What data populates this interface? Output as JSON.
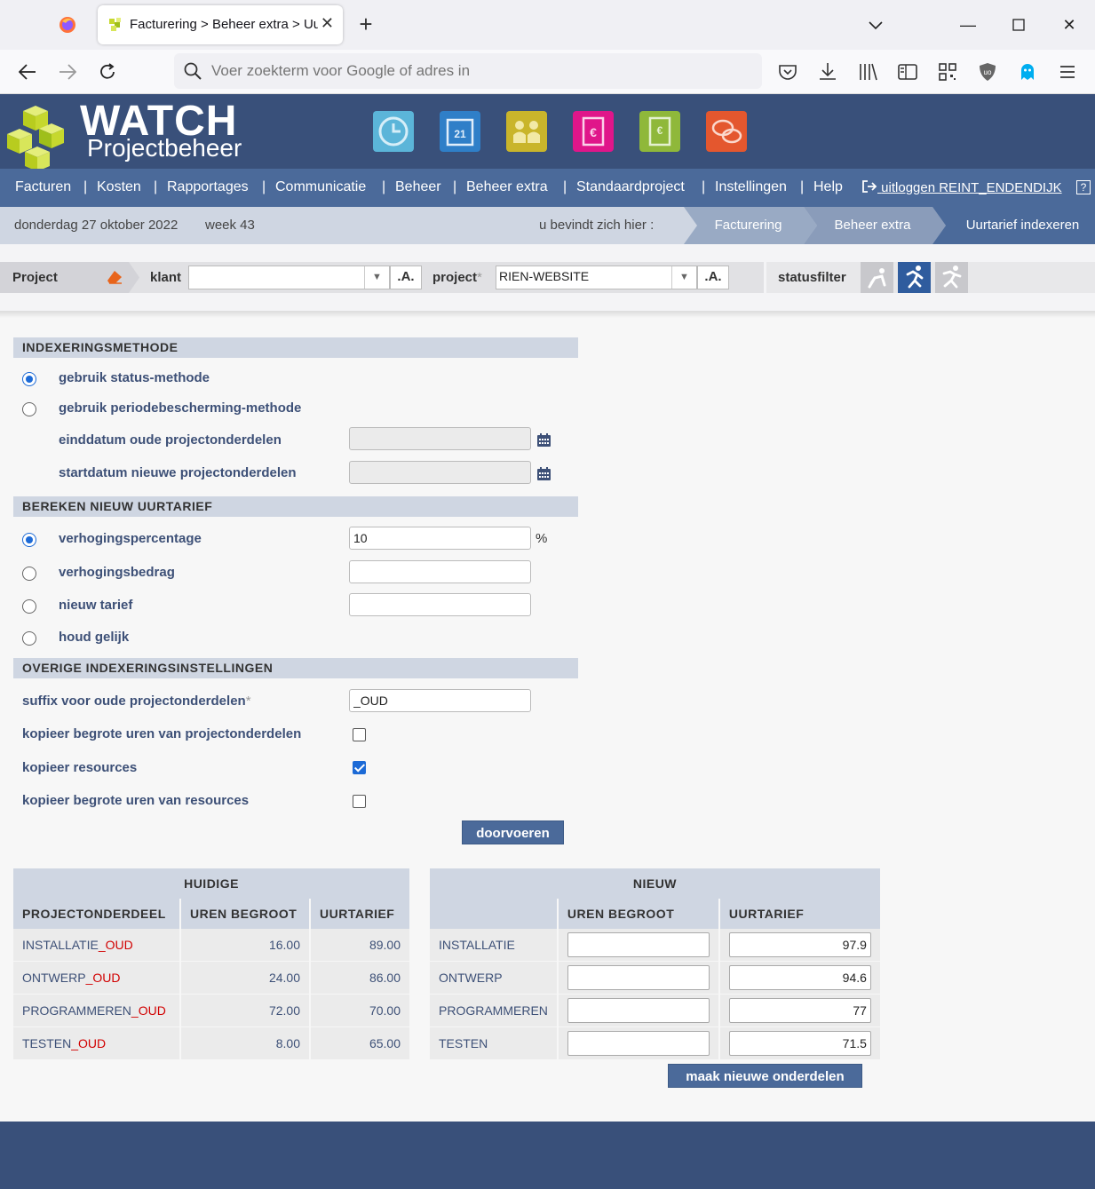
{
  "browser": {
    "tab_title": "Facturering > Beheer extra > Uurtarief indexeren",
    "url_placeholder": "Voer zoekterm voor Google of adres in"
  },
  "app": {
    "logo_title": "WATCH",
    "logo_subtitle": "Projectbeheer",
    "menu": [
      "Facturen",
      "Kosten",
      "Rapportages",
      "Communicatie",
      "Beheer",
      "Beheer extra",
      "Standaardproject",
      "Instellingen",
      "Help"
    ],
    "logout": "uitloggen REINT_ENDENDIJK",
    "help_icon": "?"
  },
  "datebar": {
    "date": "donderdag 27 oktober 2022",
    "week": "week 43",
    "here_label": "u bevindt zich hier :",
    "breadcrumb": [
      "Facturering",
      "Beheer extra",
      "Uurtarief indexeren"
    ]
  },
  "filter": {
    "project_label": "Project",
    "klant_label": "klant",
    "klant_value": "",
    "project_field_label": "project",
    "required_mark": "*",
    "project_value": "RIEN-WEBSITE",
    "a_button": ".A.",
    "statusfilter_label": "statusfilter"
  },
  "form": {
    "section1_title": "INDEXERINGSMETHODE",
    "opt_status": "gebruik status-methode",
    "opt_periode": "gebruik periodebescherming-methode",
    "einddatum_label": "einddatum oude projectonderdelen",
    "startdatum_label": "startdatum nieuwe projectonderdelen",
    "section2_title": "BEREKEN NIEUW UURTARIEF",
    "opt_percentage": "verhogingspercentage",
    "percentage_value": "10",
    "percent_sign": "%",
    "opt_bedrag": "verhogingsbedrag",
    "opt_nieuw": "nieuw tarief",
    "opt_gelijk": "houd gelijk",
    "section3_title": "OVERIGE INDEXERINGSINSTELLINGEN",
    "suffix_label": "suffix voor oude projectonderdelen",
    "suffix_value": "_OUD",
    "copy_hours_parts": "kopieer begrote uren van projectonderdelen",
    "copy_resources": "kopieer resources",
    "copy_hours_resources": "kopieer begrote uren van resources",
    "submit": "doorvoeren"
  },
  "current_table": {
    "title": "HUIDIGE",
    "headers": [
      "PROJECTONDERDEEL",
      "UREN BEGROOT",
      "UURTARIEF"
    ],
    "suffix": "_OUD",
    "rows": [
      {
        "name": "INSTALLATIE",
        "hours": "16.00",
        "rate": "89.00"
      },
      {
        "name": "ONTWERP",
        "hours": "24.00",
        "rate": "86.00"
      },
      {
        "name": "PROGRAMMEREN",
        "hours": "72.00",
        "rate": "70.00"
      },
      {
        "name": "TESTEN",
        "hours": "8.00",
        "rate": "65.00"
      }
    ]
  },
  "new_table": {
    "title": "NIEUW",
    "headers": [
      "",
      "UREN BEGROOT",
      "UURTARIEF"
    ],
    "rows": [
      {
        "name": "INSTALLATIE",
        "hours": "",
        "rate": "97.9"
      },
      {
        "name": "ONTWERP",
        "hours": "",
        "rate": "94.6"
      },
      {
        "name": "PROGRAMMEREN",
        "hours": "",
        "rate": "77"
      },
      {
        "name": "TESTEN",
        "hours": "",
        "rate": "71.5"
      }
    ],
    "button": "maak nieuwe onderdelen"
  },
  "colors": {
    "header_bg": "#39507a",
    "menu_bg": "#4b6a9a",
    "section_bg": "#cfd6e2",
    "label_text": "#3d5077",
    "suffix_red": "#d10000"
  }
}
